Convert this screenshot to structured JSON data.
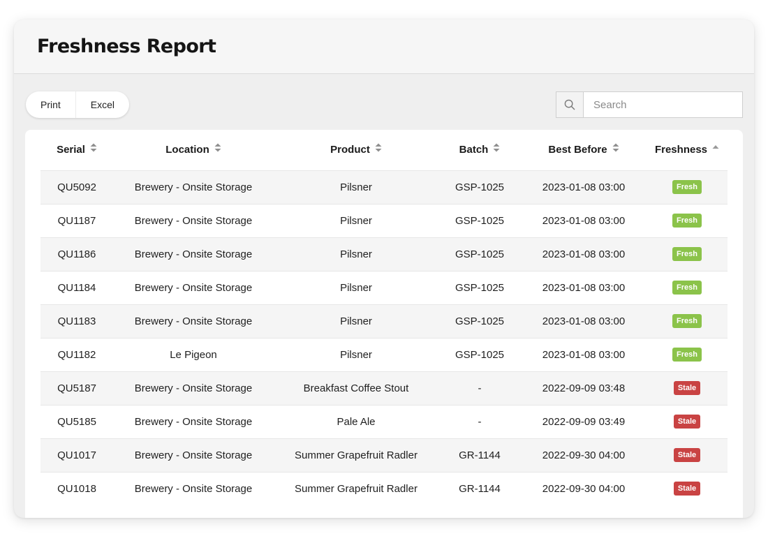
{
  "page": {
    "title": "Freshness Report"
  },
  "toolbar": {
    "buttons": [
      "Print",
      "Excel"
    ],
    "search": {
      "placeholder": "Search",
      "value": "",
      "icon": "search-icon"
    }
  },
  "table": {
    "columns": [
      {
        "label": "Serial",
        "sort": "none"
      },
      {
        "label": "Location",
        "sort": "none"
      },
      {
        "label": "Product",
        "sort": "none"
      },
      {
        "label": "Batch",
        "sort": "none"
      },
      {
        "label": "Best Before",
        "sort": "none"
      },
      {
        "label": "Freshness",
        "sort": "asc"
      }
    ],
    "rows": [
      {
        "serial": "QU5092",
        "location": "Brewery - Onsite Storage",
        "product": "Pilsner",
        "batch": "GSP-1025",
        "best_before": "2023-01-08 03:00",
        "freshness": "Fresh"
      },
      {
        "serial": "QU1187",
        "location": "Brewery - Onsite Storage",
        "product": "Pilsner",
        "batch": "GSP-1025",
        "best_before": "2023-01-08 03:00",
        "freshness": "Fresh"
      },
      {
        "serial": "QU1186",
        "location": "Brewery - Onsite Storage",
        "product": "Pilsner",
        "batch": "GSP-1025",
        "best_before": "2023-01-08 03:00",
        "freshness": "Fresh"
      },
      {
        "serial": "QU1184",
        "location": "Brewery - Onsite Storage",
        "product": "Pilsner",
        "batch": "GSP-1025",
        "best_before": "2023-01-08 03:00",
        "freshness": "Fresh"
      },
      {
        "serial": "QU1183",
        "location": "Brewery - Onsite Storage",
        "product": "Pilsner",
        "batch": "GSP-1025",
        "best_before": "2023-01-08 03:00",
        "freshness": "Fresh"
      },
      {
        "serial": "QU1182",
        "location": "Le Pigeon",
        "product": "Pilsner",
        "batch": "GSP-1025",
        "best_before": "2023-01-08 03:00",
        "freshness": "Fresh"
      },
      {
        "serial": "QU5187",
        "location": "Brewery - Onsite Storage",
        "product": "Breakfast Coffee Stout",
        "batch": "-",
        "best_before": "2022-09-09 03:48",
        "freshness": "Stale"
      },
      {
        "serial": "QU5185",
        "location": "Brewery - Onsite Storage",
        "product": "Pale Ale",
        "batch": "-",
        "best_before": "2022-09-09 03:49",
        "freshness": "Stale"
      },
      {
        "serial": "QU1017",
        "location": "Brewery - Onsite Storage",
        "product": "Summer Grapefruit Radler",
        "batch": "GR-1144",
        "best_before": "2022-09-30 04:00",
        "freshness": "Stale"
      },
      {
        "serial": "QU1018",
        "location": "Brewery - Onsite Storage",
        "product": "Summer Grapefruit Radler",
        "batch": "GR-1144",
        "best_before": "2022-09-30 04:00",
        "freshness": "Stale"
      }
    ]
  },
  "colors": {
    "fresh": "#8bc34a",
    "stale": "#c94343"
  }
}
